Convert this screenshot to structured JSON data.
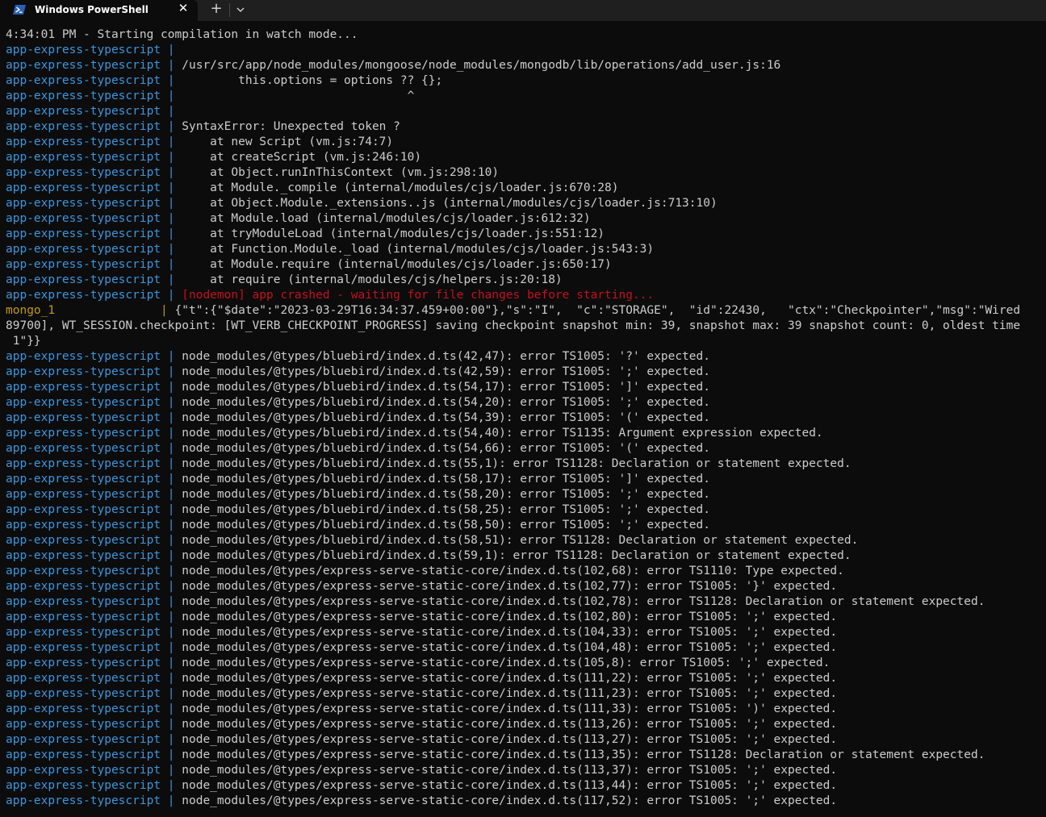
{
  "window": {
    "tab_title": "Windows PowerShell",
    "tab_icon": "powershell-icon",
    "close_icon": "close-icon",
    "new_tab_icon": "plus-icon",
    "dropdown_icon": "chevron-down-icon"
  },
  "colors": {
    "background": "#0c0c0c",
    "titlebar": "#1f1f1f",
    "text": "#cccccc",
    "app_prefix": "#3a96dd",
    "mongo_prefix": "#c19c00",
    "error_red": "#c50f1f",
    "powershell_blue": "#2b5fb3"
  },
  "terminal": {
    "header": "4:34:01 PM - Starting compilation in watch mode...",
    "prefixes": {
      "app": "app-express-typescript |",
      "mongo": "mongo_1               |"
    },
    "stack": [
      "",
      "/usr/src/app/node_modules/mongoose/node_modules/mongodb/lib/operations/add_user.js:16",
      "        this.options = options ?? {};",
      "                                ^",
      "",
      "SyntaxError: Unexpected token ?",
      "    at new Script (vm.js:74:7)",
      "    at createScript (vm.js:246:10)",
      "    at Object.runInThisContext (vm.js:298:10)",
      "    at Module._compile (internal/modules/cjs/loader.js:670:28)",
      "    at Object.Module._extensions..js (internal/modules/cjs/loader.js:713:10)",
      "    at Module.load (internal/modules/cjs/loader.js:612:32)",
      "    at tryModuleLoad (internal/modules/cjs/loader.js:551:12)",
      "    at Function.Module._load (internal/modules/cjs/loader.js:543:3)",
      "    at Module.require (internal/modules/cjs/loader.js:650:17)",
      "    at require (internal/modules/cjs/helpers.js:20:18)"
    ],
    "crash": "[nodemon] app crashed - waiting for file changes before starting...",
    "mongo_log": "{\"t\":{\"$date\":\"2023-03-29T16:34:37.459+00:00\"},\"s\":\"I\",  \"c\":\"STORAGE\",  \"id\":22430,   \"ctx\":\"Checkpointer\",\"msg\":\"Wired",
    "mongo_wrap1": "89700], WT_SESSION.checkpoint: [WT_VERB_CHECKPOINT_PROGRESS] saving checkpoint snapshot min: 39, snapshot max: 39 snapshot count: 0, oldest time",
    "mongo_wrap2": " 1\"}}",
    "errors": [
      "node_modules/@types/bluebird/index.d.ts(42,47): error TS1005: '?' expected.",
      "node_modules/@types/bluebird/index.d.ts(42,59): error TS1005: ';' expected.",
      "node_modules/@types/bluebird/index.d.ts(54,17): error TS1005: ']' expected.",
      "node_modules/@types/bluebird/index.d.ts(54,20): error TS1005: ';' expected.",
      "node_modules/@types/bluebird/index.d.ts(54,39): error TS1005: '(' expected.",
      "node_modules/@types/bluebird/index.d.ts(54,40): error TS1135: Argument expression expected.",
      "node_modules/@types/bluebird/index.d.ts(54,66): error TS1005: '(' expected.",
      "node_modules/@types/bluebird/index.d.ts(55,1): error TS1128: Declaration or statement expected.",
      "node_modules/@types/bluebird/index.d.ts(58,17): error TS1005: ']' expected.",
      "node_modules/@types/bluebird/index.d.ts(58,20): error TS1005: ';' expected.",
      "node_modules/@types/bluebird/index.d.ts(58,25): error TS1005: ';' expected.",
      "node_modules/@types/bluebird/index.d.ts(58,50): error TS1005: ';' expected.",
      "node_modules/@types/bluebird/index.d.ts(58,51): error TS1128: Declaration or statement expected.",
      "node_modules/@types/bluebird/index.d.ts(59,1): error TS1128: Declaration or statement expected.",
      "node_modules/@types/express-serve-static-core/index.d.ts(102,68): error TS1110: Type expected.",
      "node_modules/@types/express-serve-static-core/index.d.ts(102,77): error TS1005: '}' expected.",
      "node_modules/@types/express-serve-static-core/index.d.ts(102,78): error TS1128: Declaration or statement expected.",
      "node_modules/@types/express-serve-static-core/index.d.ts(102,80): error TS1005: ';' expected.",
      "node_modules/@types/express-serve-static-core/index.d.ts(104,33): error TS1005: ';' expected.",
      "node_modules/@types/express-serve-static-core/index.d.ts(104,48): error TS1005: ';' expected.",
      "node_modules/@types/express-serve-static-core/index.d.ts(105,8): error TS1005: ';' expected.",
      "node_modules/@types/express-serve-static-core/index.d.ts(111,22): error TS1005: ';' expected.",
      "node_modules/@types/express-serve-static-core/index.d.ts(111,23): error TS1005: ';' expected.",
      "node_modules/@types/express-serve-static-core/index.d.ts(111,33): error TS1005: ')' expected.",
      "node_modules/@types/express-serve-static-core/index.d.ts(113,26): error TS1005: ';' expected.",
      "node_modules/@types/express-serve-static-core/index.d.ts(113,27): error TS1005: ';' expected.",
      "node_modules/@types/express-serve-static-core/index.d.ts(113,35): error TS1128: Declaration or statement expected.",
      "node_modules/@types/express-serve-static-core/index.d.ts(113,37): error TS1005: ';' expected.",
      "node_modules/@types/express-serve-static-core/index.d.ts(113,44): error TS1005: ';' expected.",
      "node_modules/@types/express-serve-static-core/index.d.ts(117,52): error TS1005: ';' expected."
    ]
  }
}
